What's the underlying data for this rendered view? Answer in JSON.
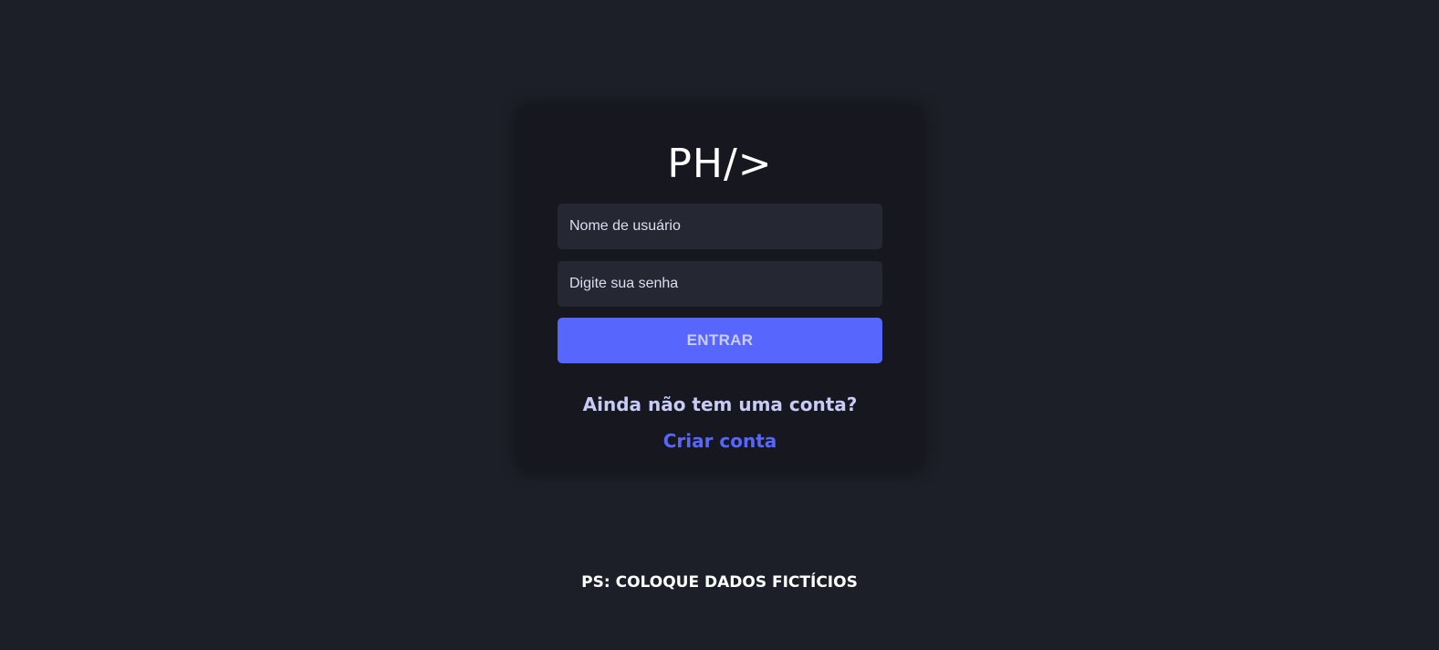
{
  "login": {
    "logo": "PH/>",
    "username_placeholder": "Nome de usuário",
    "password_placeholder": "Digite sua senha",
    "submit_label": "ENTRAR",
    "no_account_text": "Ainda não tem uma conta?",
    "create_account_label": "Criar conta"
  },
  "footer": {
    "note": "PS: COLOQUE DADOS FICTÍCIOS"
  },
  "colors": {
    "background": "#1c1f27",
    "card": "#17181f",
    "input": "#252833",
    "accent": "#5766fd"
  }
}
